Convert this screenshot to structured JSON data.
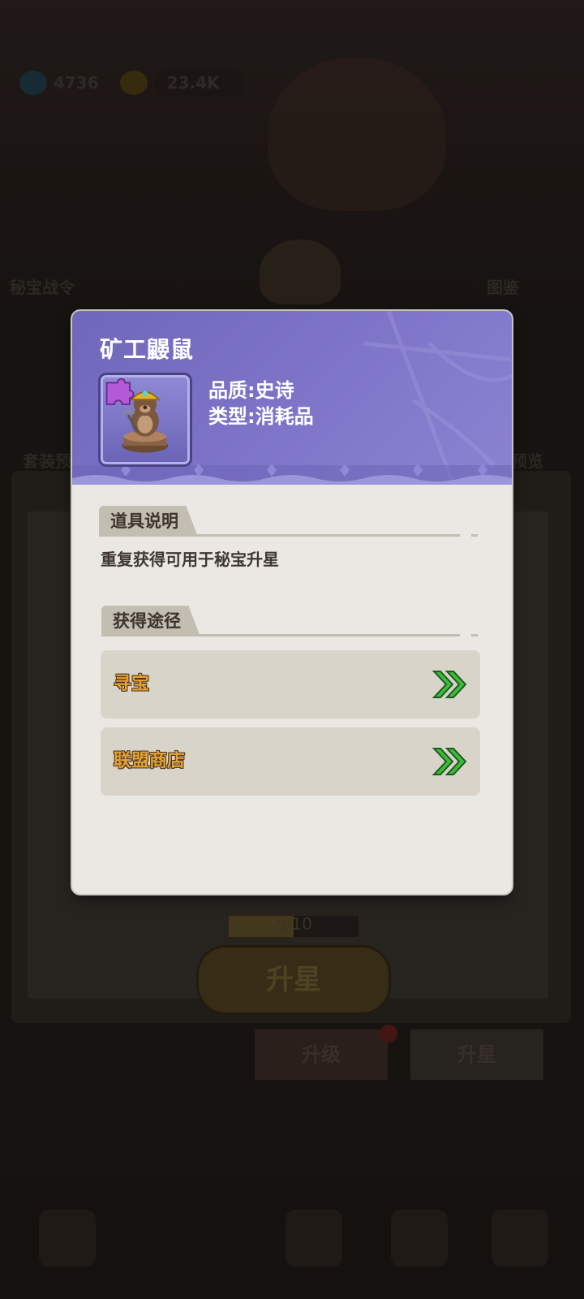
{
  "background": {
    "resources": [
      {
        "name": "gem-icon",
        "value": "4736"
      },
      {
        "name": "coin-icon",
        "value": "23.4K"
      }
    ],
    "side_left": "秘宝战令",
    "side_right": "图鉴",
    "side_left2": "套装预",
    "side_right2": "星预览",
    "progress": {
      "text": "5/10",
      "fraction": 0.5
    },
    "upstar_button": "升星",
    "tabs": [
      "升级",
      "升星"
    ]
  },
  "dialog": {
    "title": "矿工鼹鼠",
    "item_icon": "mole-miner-statue-icon",
    "quality": "品质:史诗",
    "type": "类型:消耗品",
    "description_header": "道具说明",
    "description": "重复获得可用于秘宝升星",
    "sources_header": "获得途径",
    "sources": [
      {
        "label": "寻宝"
      },
      {
        "label": "联盟商店"
      }
    ]
  },
  "colors": {
    "header": "#7d74c8",
    "dialog_bg": "#eae8e3",
    "source_text": "#e3a233",
    "go_arrow": "#3cbb3c"
  }
}
